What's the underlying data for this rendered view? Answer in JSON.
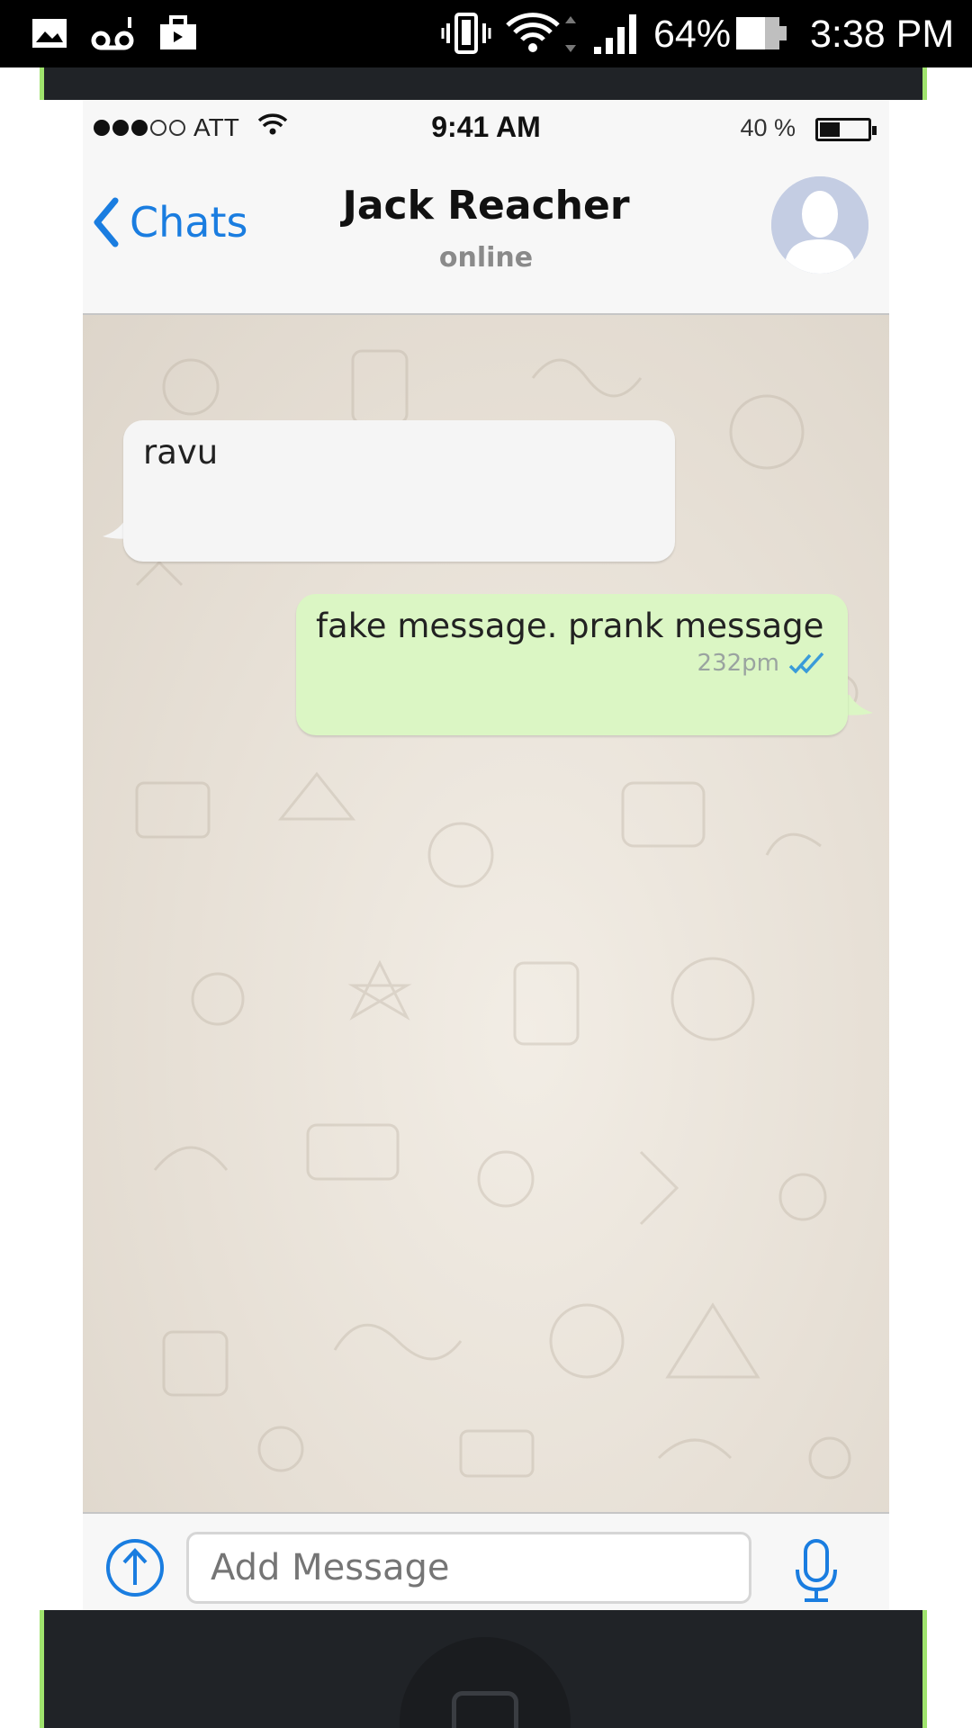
{
  "android_status": {
    "battery": "64%",
    "time": "3:38 PM",
    "icons": [
      "gallery-icon",
      "voicemail-icon",
      "briefcase-icon",
      "vibrate-icon",
      "wifi-icon",
      "signal-icon",
      "battery-icon"
    ]
  },
  "ios_status": {
    "carrier": "ATT",
    "signal_dots": 5,
    "signal_filled": 3,
    "time": "9:41 AM",
    "battery_pct": "40 %",
    "battery_level": 0.4
  },
  "nav": {
    "back_label": "Chats",
    "contact_name": "Jack Reacher",
    "status": "online"
  },
  "messages": [
    {
      "direction": "incoming",
      "text": "ravu"
    },
    {
      "direction": "outgoing",
      "text": "fake message. prank message",
      "time": "232pm",
      "ticks": "double",
      "tick_color": "#3a9bd9"
    }
  ],
  "input": {
    "placeholder": "Add Message"
  },
  "colors": {
    "accent": "#1a7de0",
    "outgoing_bubble": "#dbf6c4",
    "incoming_bubble": "#f5f5f5",
    "frame_edge": "#9fe36d"
  }
}
